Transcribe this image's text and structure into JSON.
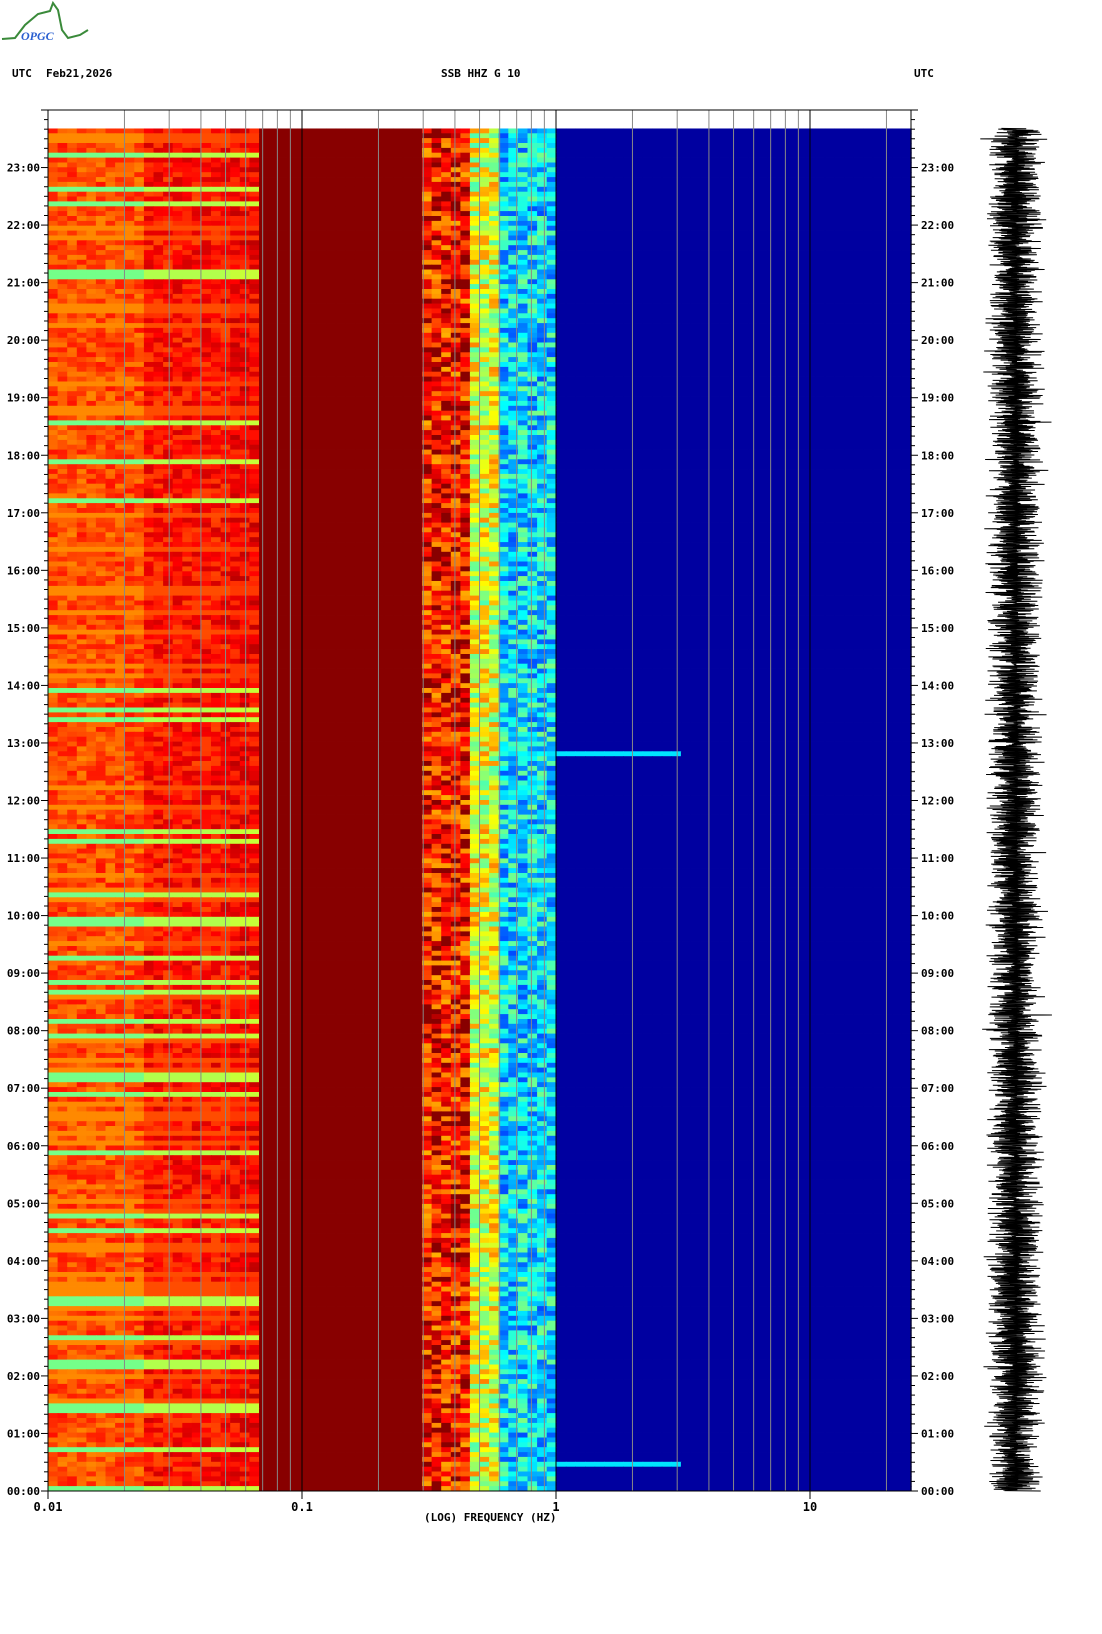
{
  "header": {
    "logo_text": "OPGC",
    "left_tz": "UTC",
    "date": "Feb21,2026",
    "station": "SSB HHZ G 10",
    "right_tz": "UTC"
  },
  "colors": {
    "background_blue": "#0000a0",
    "dark_red": "#880000",
    "grid_minor": "#888888",
    "grid_major": "#000000"
  },
  "chart_data": {
    "type": "heatmap",
    "title": "SSB HHZ G 10",
    "xlabel": "(LOG) FREQUENCY (HZ)",
    "ylabel": "UTC",
    "xscale": "log",
    "xlim": [
      0.01,
      25
    ],
    "ylim_hours": [
      0,
      24
    ],
    "data_end_hour": 23.68,
    "x_ticks": [
      {
        "value": 0.01,
        "label": "0.01"
      },
      {
        "value": 0.1,
        "label": "0.1"
      },
      {
        "value": 1,
        "label": "1"
      },
      {
        "value": 10,
        "label": "10"
      }
    ],
    "y_ticks": [
      "00:00",
      "01:00",
      "02:00",
      "03:00",
      "04:00",
      "05:00",
      "06:00",
      "07:00",
      "08:00",
      "09:00",
      "10:00",
      "11:00",
      "12:00",
      "13:00",
      "14:00",
      "15:00",
      "16:00",
      "17:00",
      "18:00",
      "19:00",
      "20:00",
      "21:00",
      "22:00",
      "23:00"
    ],
    "grid": true,
    "bands": [
      {
        "fmin": 0.01,
        "fmax": 0.024,
        "level": 0.82
      },
      {
        "fmin": 0.024,
        "fmax": 0.05,
        "level": 0.88
      },
      {
        "fmin": 0.05,
        "fmax": 0.07,
        "level": 0.9
      },
      {
        "fmin": 0.07,
        "fmax": 0.3,
        "level": 0.97
      },
      {
        "fmin": 0.3,
        "fmax": 0.45,
        "level": 0.85
      },
      {
        "fmin": 0.45,
        "fmax": 0.6,
        "level": 0.6
      },
      {
        "fmin": 0.6,
        "fmax": 1.0,
        "level": 0.35
      },
      {
        "fmin": 1.0,
        "fmax": 25,
        "level": 0.1
      }
    ],
    "events": [
      {
        "hour": 0.52,
        "fmin": 0.3,
        "fmax": 3.0
      },
      {
        "hour": 12.85,
        "fmin": 0.7,
        "fmax": 3.0
      }
    ],
    "waveform": "continuous seismic trace 00:00-23:40 UTC"
  }
}
